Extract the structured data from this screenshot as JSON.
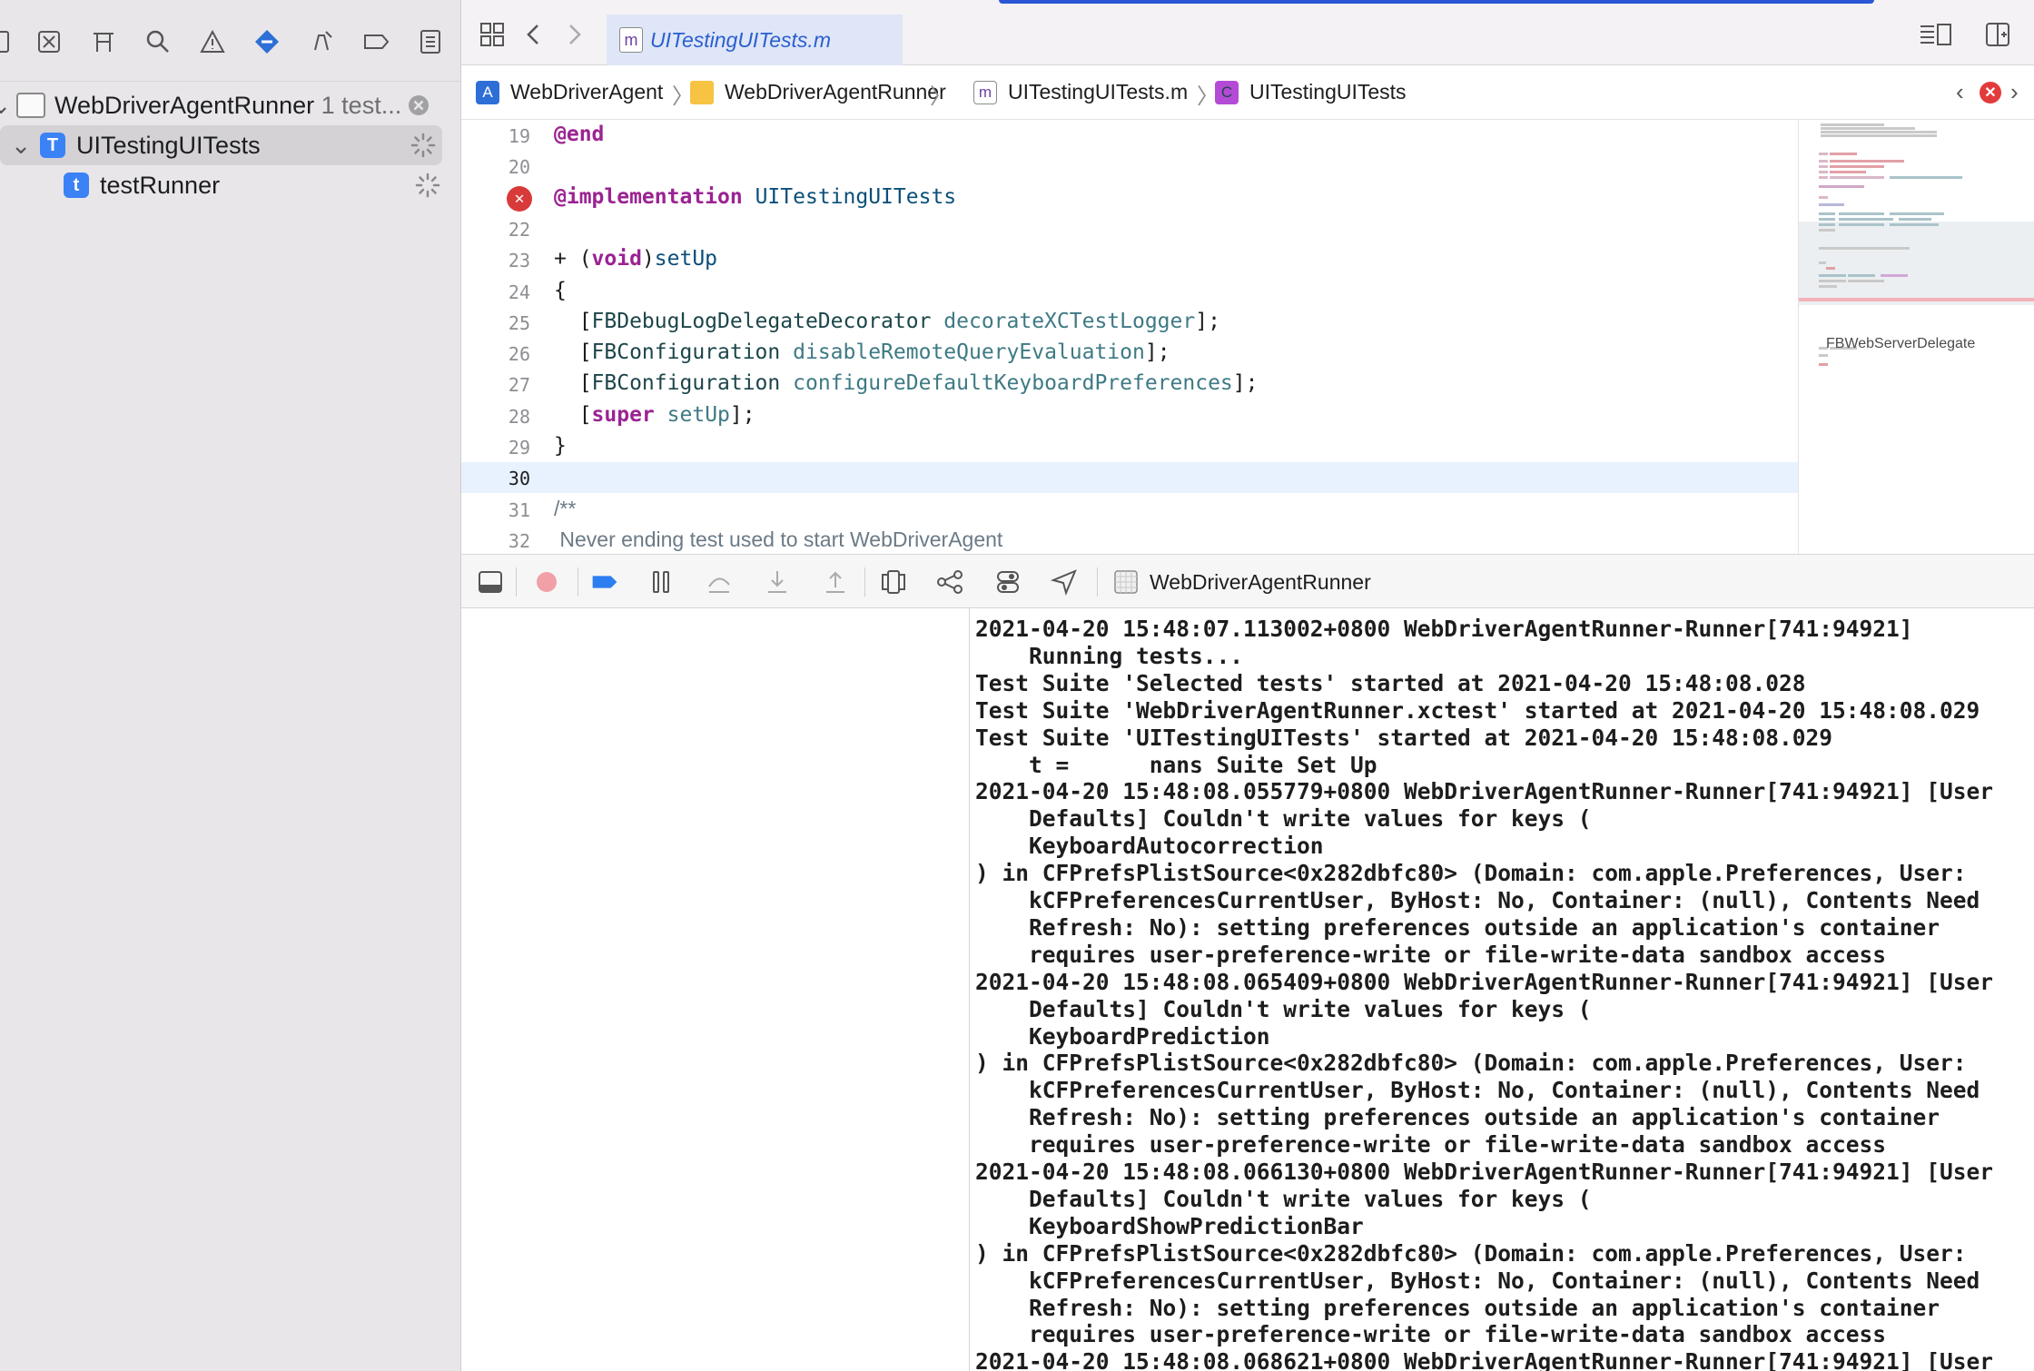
{
  "navigator": {
    "tree": [
      {
        "label": "WebDriverAgentRunner",
        "sublabel": "1 test...",
        "indent": 0
      },
      {
        "label": "UITestingUITests",
        "badge": "T",
        "indent": 1
      },
      {
        "label": "testRunner",
        "badge": "t",
        "indent": 2
      }
    ]
  },
  "tab": {
    "active_title": "UITestingUITests.m",
    "file_glyph": "m"
  },
  "jump_bar": {
    "crumbs": [
      "WebDriverAgent",
      "WebDriverAgentRunner",
      "UITestingUITests.m",
      "UITestingUITests"
    ],
    "class_glyph": "C"
  },
  "editor": {
    "lines": [
      {
        "n": "19",
        "html_tokens": [
          [
            "kw",
            "@end"
          ]
        ]
      },
      {
        "n": "20",
        "html_tokens": []
      },
      {
        "n": "",
        "error": true,
        "html_tokens": [
          [
            "kw",
            "@implementation"
          ],
          [
            "",
            " "
          ],
          [
            "ty",
            "UITestingUITests"
          ]
        ]
      },
      {
        "n": "22",
        "html_tokens": []
      },
      {
        "n": "23",
        "html_tokens": [
          [
            "",
            "+ ("
          ],
          [
            "kw",
            "void"
          ],
          [
            "",
            ")"
          ],
          [
            "ty",
            "setUp"
          ]
        ]
      },
      {
        "n": "24",
        "html_tokens": [
          [
            "",
            "{"
          ]
        ]
      },
      {
        "n": "25",
        "html_tokens": [
          [
            "",
            "  ["
          ],
          [
            "cls",
            "FBDebugLogDelegateDecorator"
          ],
          [
            "",
            " "
          ],
          [
            "mth",
            "decorateXCTestLogger"
          ],
          [
            "",
            "];"
          ]
        ]
      },
      {
        "n": "26",
        "html_tokens": [
          [
            "",
            "  ["
          ],
          [
            "cls",
            "FBConfiguration"
          ],
          [
            "",
            " "
          ],
          [
            "mth",
            "disableRemoteQueryEvaluation"
          ],
          [
            "",
            "];"
          ]
        ]
      },
      {
        "n": "27",
        "html_tokens": [
          [
            "",
            "  ["
          ],
          [
            "cls",
            "FBConfiguration"
          ],
          [
            "",
            " "
          ],
          [
            "mth",
            "configureDefaultKeyboardPreferences"
          ],
          [
            "",
            "];"
          ]
        ]
      },
      {
        "n": "28",
        "html_tokens": [
          [
            "",
            "  ["
          ],
          [
            "kw",
            "super"
          ],
          [
            "",
            " "
          ],
          [
            "mth",
            "setUp"
          ],
          [
            "",
            "];"
          ]
        ]
      },
      {
        "n": "29",
        "html_tokens": [
          [
            "",
            "}"
          ]
        ]
      },
      {
        "n": "30",
        "current": true,
        "html_tokens": []
      },
      {
        "n": "31",
        "comment": true,
        "html_tokens": [
          [
            "",
            "/**"
          ]
        ]
      },
      {
        "n": "32",
        "comment": true,
        "html_tokens": [
          [
            "",
            " Never ending test used to start WebDriverAgent"
          ]
        ]
      }
    ]
  },
  "minimap": {
    "label": "FBWebServerDelegate"
  },
  "debug_bar": {
    "target": "WebDriverAgentRunner"
  },
  "console": {
    "lines": [
      "2021-04-20 15:48:07.113002+0800 WebDriverAgentRunner-Runner[741:94921]",
      "    Running tests...",
      "Test Suite 'Selected tests' started at 2021-04-20 15:48:08.028",
      "Test Suite 'WebDriverAgentRunner.xctest' started at 2021-04-20 15:48:08.029",
      "Test Suite 'UITestingUITests' started at 2021-04-20 15:48:08.029",
      "    t =      nans Suite Set Up",
      "2021-04-20 15:48:08.055779+0800 WebDriverAgentRunner-Runner[741:94921] [User",
      "    Defaults] Couldn't write values for keys (",
      "    KeyboardAutocorrection",
      ") in CFPrefsPlistSource<0x282dbfc80> (Domain: com.apple.Preferences, User:",
      "    kCFPreferencesCurrentUser, ByHost: No, Container: (null), Contents Need",
      "    Refresh: No): setting preferences outside an application's container",
      "    requires user-preference-write or file-write-data sandbox access",
      "2021-04-20 15:48:08.065409+0800 WebDriverAgentRunner-Runner[741:94921] [User",
      "    Defaults] Couldn't write values for keys (",
      "    KeyboardPrediction",
      ") in CFPrefsPlistSource<0x282dbfc80> (Domain: com.apple.Preferences, User:",
      "    kCFPreferencesCurrentUser, ByHost: No, Container: (null), Contents Need",
      "    Refresh: No): setting preferences outside an application's container",
      "    requires user-preference-write or file-write-data sandbox access",
      "2021-04-20 15:48:08.066130+0800 WebDriverAgentRunner-Runner[741:94921] [User",
      "    Defaults] Couldn't write values for keys (",
      "    KeyboardShowPredictionBar",
      ") in CFPrefsPlistSource<0x282dbfc80> (Domain: com.apple.Preferences, User:",
      "    kCFPreferencesCurrentUser, ByHost: No, Container: (null), Contents Need",
      "    Refresh: No): setting preferences outside an application's container",
      "    requires user-preference-write or file-write-data sandbox access",
      "2021-04-20 15:48:08.068621+0800 WebDriverAgentRunner-Runner[741:94921] [User"
    ]
  },
  "colors": {
    "accent": "#2b57d6",
    "selection": "#d4d2d5",
    "keyword": "#9b2393",
    "error": "#d83a3a"
  },
  "icons": {
    "navigator_tools": [
      "folder-icon",
      "source-control-icon",
      "symbol-icon",
      "search-icon",
      "issue-icon",
      "test-icon",
      "debug-icon",
      "breakpoint-icon",
      "report-icon"
    ],
    "debug_tools": [
      "hide-debug-area-icon",
      "breakpoints-toggle-icon",
      "breakpoint-active-icon",
      "pause-icon",
      "step-over-icon",
      "step-into-icon",
      "step-out-icon",
      "view-hierarchy-icon",
      "memory-graph-icon",
      "environment-icon",
      "location-icon"
    ]
  }
}
